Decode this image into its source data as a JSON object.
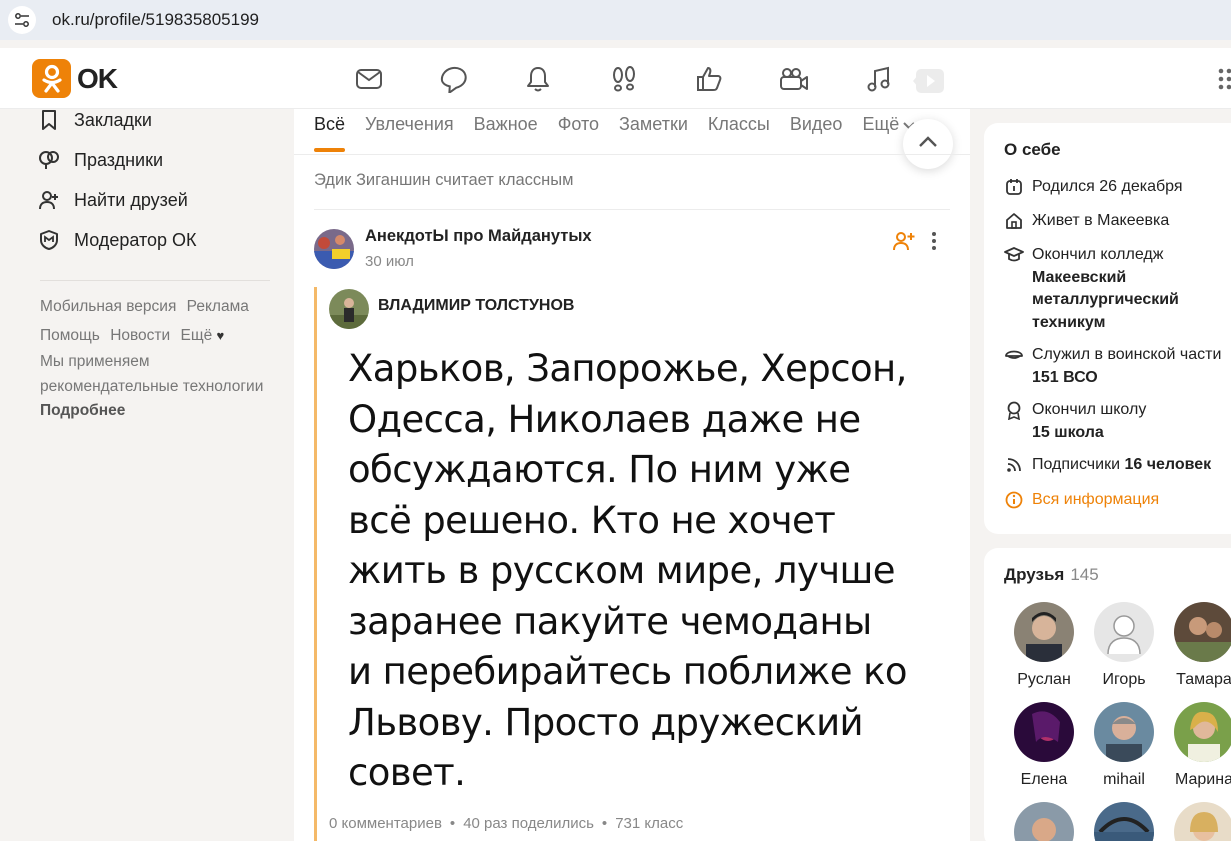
{
  "browser": {
    "url": "ok.ru/profile/519835805199"
  },
  "header": {
    "logo_text": "OK"
  },
  "sidebar": {
    "items": [
      {
        "label": "Закладки",
        "icon": "bookmark-icon"
      },
      {
        "label": "Праздники",
        "icon": "balloons-icon"
      },
      {
        "label": "Найти друзей",
        "icon": "add-friend-icon"
      },
      {
        "label": "Модератор ОК",
        "icon": "moderator-shield-icon"
      }
    ],
    "footer_links": [
      "Мобильная версия",
      "Реклама",
      "Помощь",
      "Новости",
      "Ещё"
    ],
    "note": "Мы применяем рекомендательные технологии",
    "note_link": "Подробнее"
  },
  "feed": {
    "tabs": [
      "Всё",
      "Увлечения",
      "Важное",
      "Фото",
      "Заметки",
      "Классы",
      "Видео",
      "Ещё"
    ],
    "activity": "Эдик Зиганшин считает классным",
    "post": {
      "group": "АнекдотЫ про Майданутых",
      "date": "30 июл",
      "repost_author": "ВЛАДИМИР ТОЛСТУНОВ",
      "text_lines": [
        "Харьков, Запорожье, Херсон,",
        "Одесса, Николаев даже не",
        "обсуждаются. По ним уже",
        "всё решено. Кто не хочет",
        "жить в русском мире, лучше",
        "заранее пакуйте чемоданы",
        "и перебирайтесь поближе ко",
        "Львову. Просто дружеский",
        "совет."
      ],
      "comments": "0 комментариев",
      "shares": "40 раз поделились",
      "likes": "731 класс"
    }
  },
  "about": {
    "title": "О себе",
    "birthday": "Родился 26 декабря",
    "lives_prefix": "Живет в",
    "lives_city": "Макеевка",
    "college_prefix": "Окончил колледж",
    "college_name": "Макеевский металлургический техникум",
    "military_prefix": "Служил в воинской части",
    "military_unit": "151 ВСО",
    "school_prefix": "Окончил школу",
    "school_name": "15 школа",
    "subscribers_prefix": "Подписчики",
    "subscribers_count": "16 человек",
    "all_info": "Вся информация"
  },
  "friends": {
    "title": "Друзья",
    "count": "145",
    "list": [
      "Руслан",
      "Игорь",
      "Тамара",
      "Елена",
      "mihail",
      "Марина"
    ]
  },
  "colors": {
    "accent": "#ee8208",
    "text": "#222222",
    "muted": "#777777"
  }
}
